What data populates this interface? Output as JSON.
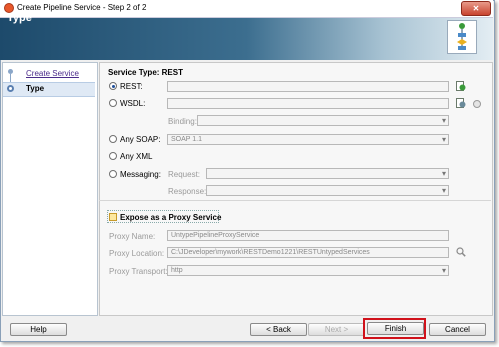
{
  "window": {
    "title": "Create Pipeline Service - Step 2 of 2",
    "close_label": "✕"
  },
  "header": {
    "title": "Type"
  },
  "nav": {
    "items": [
      {
        "label": "Create Service"
      },
      {
        "label": "Type"
      }
    ]
  },
  "form": {
    "service_type_label": "Service Type: REST",
    "rest": {
      "label": "REST:",
      "value": ""
    },
    "wsdl": {
      "label": "WSDL:",
      "value": ""
    },
    "binding": {
      "label": "Binding:",
      "value": ""
    },
    "any_soap": {
      "label": "Any SOAP:",
      "value": "SOAP 1.1"
    },
    "any_xml": {
      "label": "Any XML"
    },
    "messaging": {
      "label": "Messaging:",
      "value": ""
    },
    "request": {
      "label": "Request:",
      "value": ""
    },
    "response": {
      "label": "Response:",
      "value": ""
    },
    "expose_proxy": {
      "label": "Expose as a Proxy Service"
    },
    "proxy_name": {
      "label": "Proxy Name:",
      "value": "UntypePipelineProxyService"
    },
    "proxy_location": {
      "label": "Proxy Location:",
      "value": "C:\\JDeveloper\\mywork\\RESTDemo1221\\RESTUntypedServices"
    },
    "proxy_transport": {
      "label": "Proxy Transport:",
      "value": "http"
    }
  },
  "buttons": {
    "help": "Help",
    "back": "< Back",
    "next": "Next >",
    "finish": "Finish",
    "cancel": "Cancel"
  }
}
